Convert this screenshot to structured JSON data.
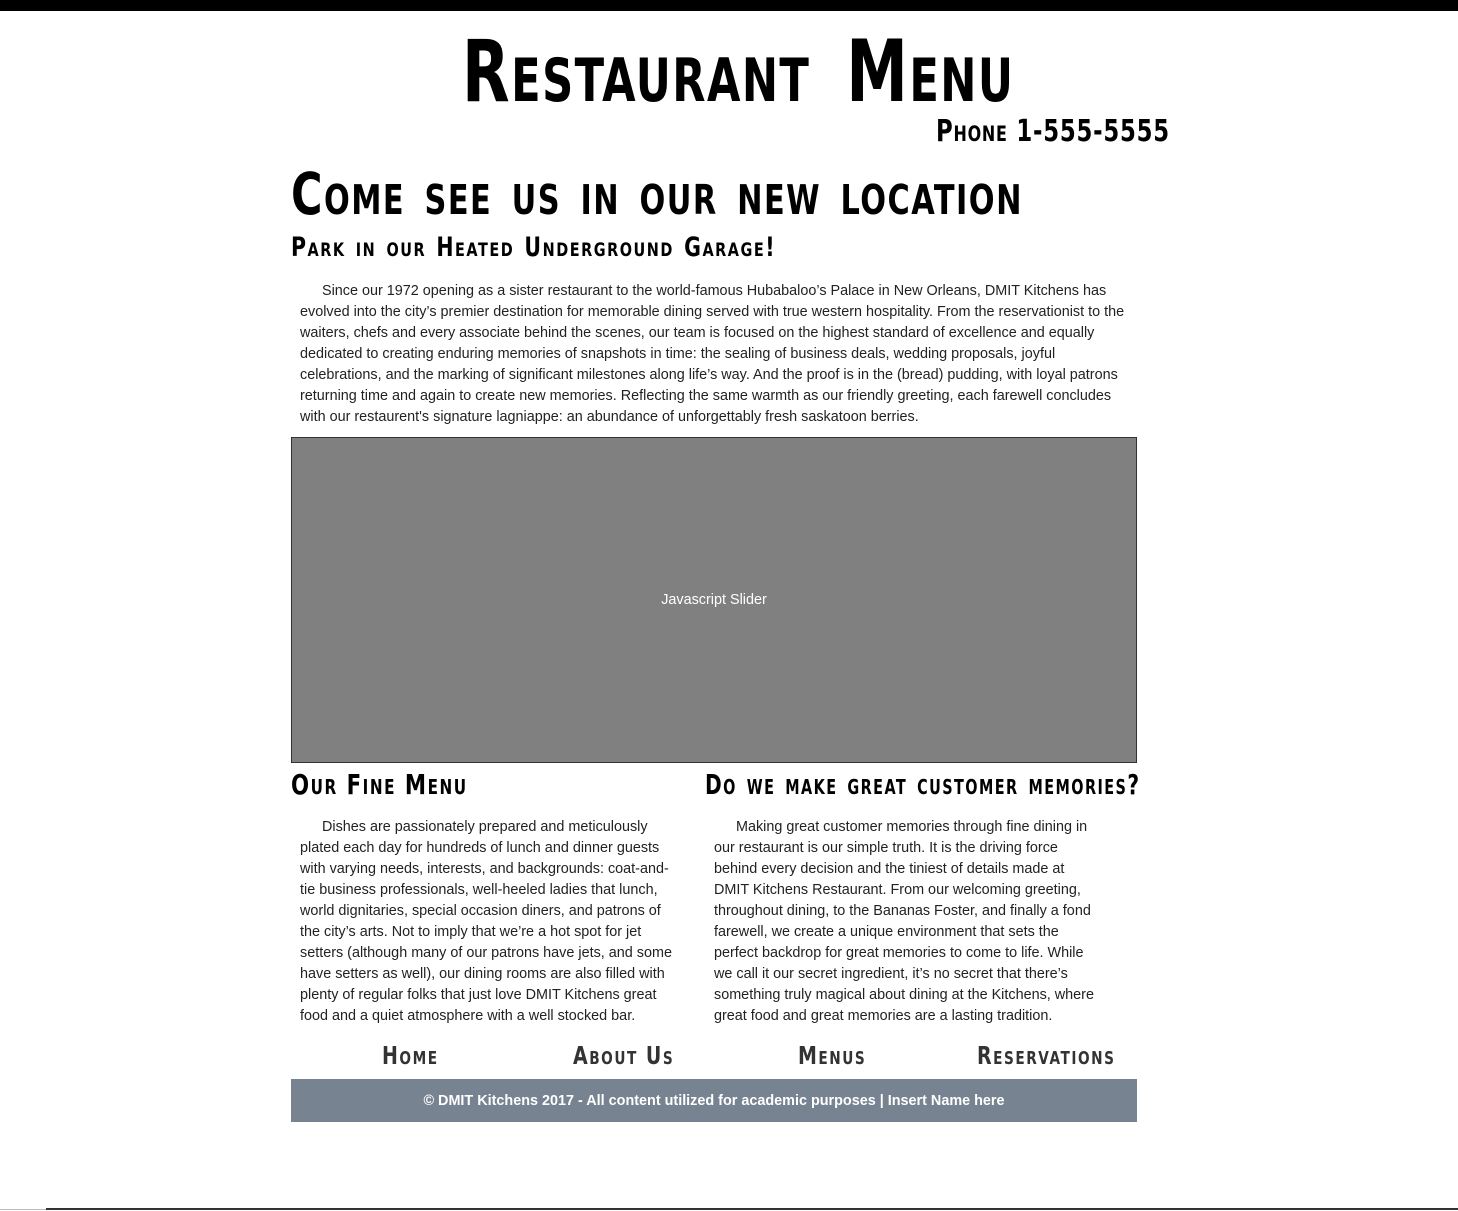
{
  "header": {
    "title": "Restaurant Menu",
    "phone": "Phone 1-555-5555"
  },
  "intro": {
    "heading": "Come see us in our new location",
    "subheading": "Park in our Heated Underground Garage!",
    "paragraph": "Since our 1972 opening as a sister restaurant to the world-famous Hubabaloo’s Palace in New Orleans, DMIT Kitchens has evolved into the city’s premier destination for memorable dining served with true western hospitality. From the reservationist to the waiters, chefs and every associate behind the scenes, our team is focused on the highest standard of excellence and equally dedicated to creating enduring memories of snapshots in time: the sealing of business deals, wedding proposals, joyful celebrations, and the marking of significant milestones along life’s way. And the proof is in the (bread) pudding, with loyal patrons returning time and again to create new memories. Reflecting the same warmth as our friendly greeting, each farewell concludes with our restaurent's signature lagniappe: an abundance of unforgettably fresh saskatoon berries."
  },
  "slider": {
    "label": "Javascript Slider"
  },
  "menu_section": {
    "heading": "Our Fine Menu",
    "paragraph": "Dishes are passionately prepared and meticulously plated each day for hundreds of lunch and dinner guests with varying needs, interests, and backgrounds: coat-and-tie business professionals, well-heeled ladies that lunch, world dignitaries, special occasion diners, and patrons of the city’s arts. Not to imply that we’re a hot spot for jet setters (although many of our patrons have jets, and some have setters as well), our dining rooms are also filled with plenty of regular folks that just love DMIT Kitchens great food and a quiet atmosphere with a well stocked bar."
  },
  "memories_section": {
    "heading": "Do we make great customer memories?",
    "paragraph": "Making great customer memories through fine dining in our restaurant is our simple truth. It is the driving force behind every decision and the tiniest of details made at DMIT Kitchens Restaurant. From our welcoming greeting, throughout dining, to the Bananas Foster, and finally a fond farewell, we create a unique environment that sets the perfect backdrop for great memories to come to life. While we call it our secret ingredient, it’s no secret that there’s something truly magical about dining at the Kitchens, where great food and great memories are a lasting tradition."
  },
  "nav": {
    "home": "Home",
    "about": "About Us",
    "menus": "Menus",
    "reservations": "Reservations"
  },
  "footer": {
    "text": "© DMIT Kitchens 2017 - All content utilized for academic purposes | Insert Name here"
  },
  "colors": {
    "footer_bg": "#778391",
    "slider_bg": "#808080",
    "topbar": "#000000"
  }
}
